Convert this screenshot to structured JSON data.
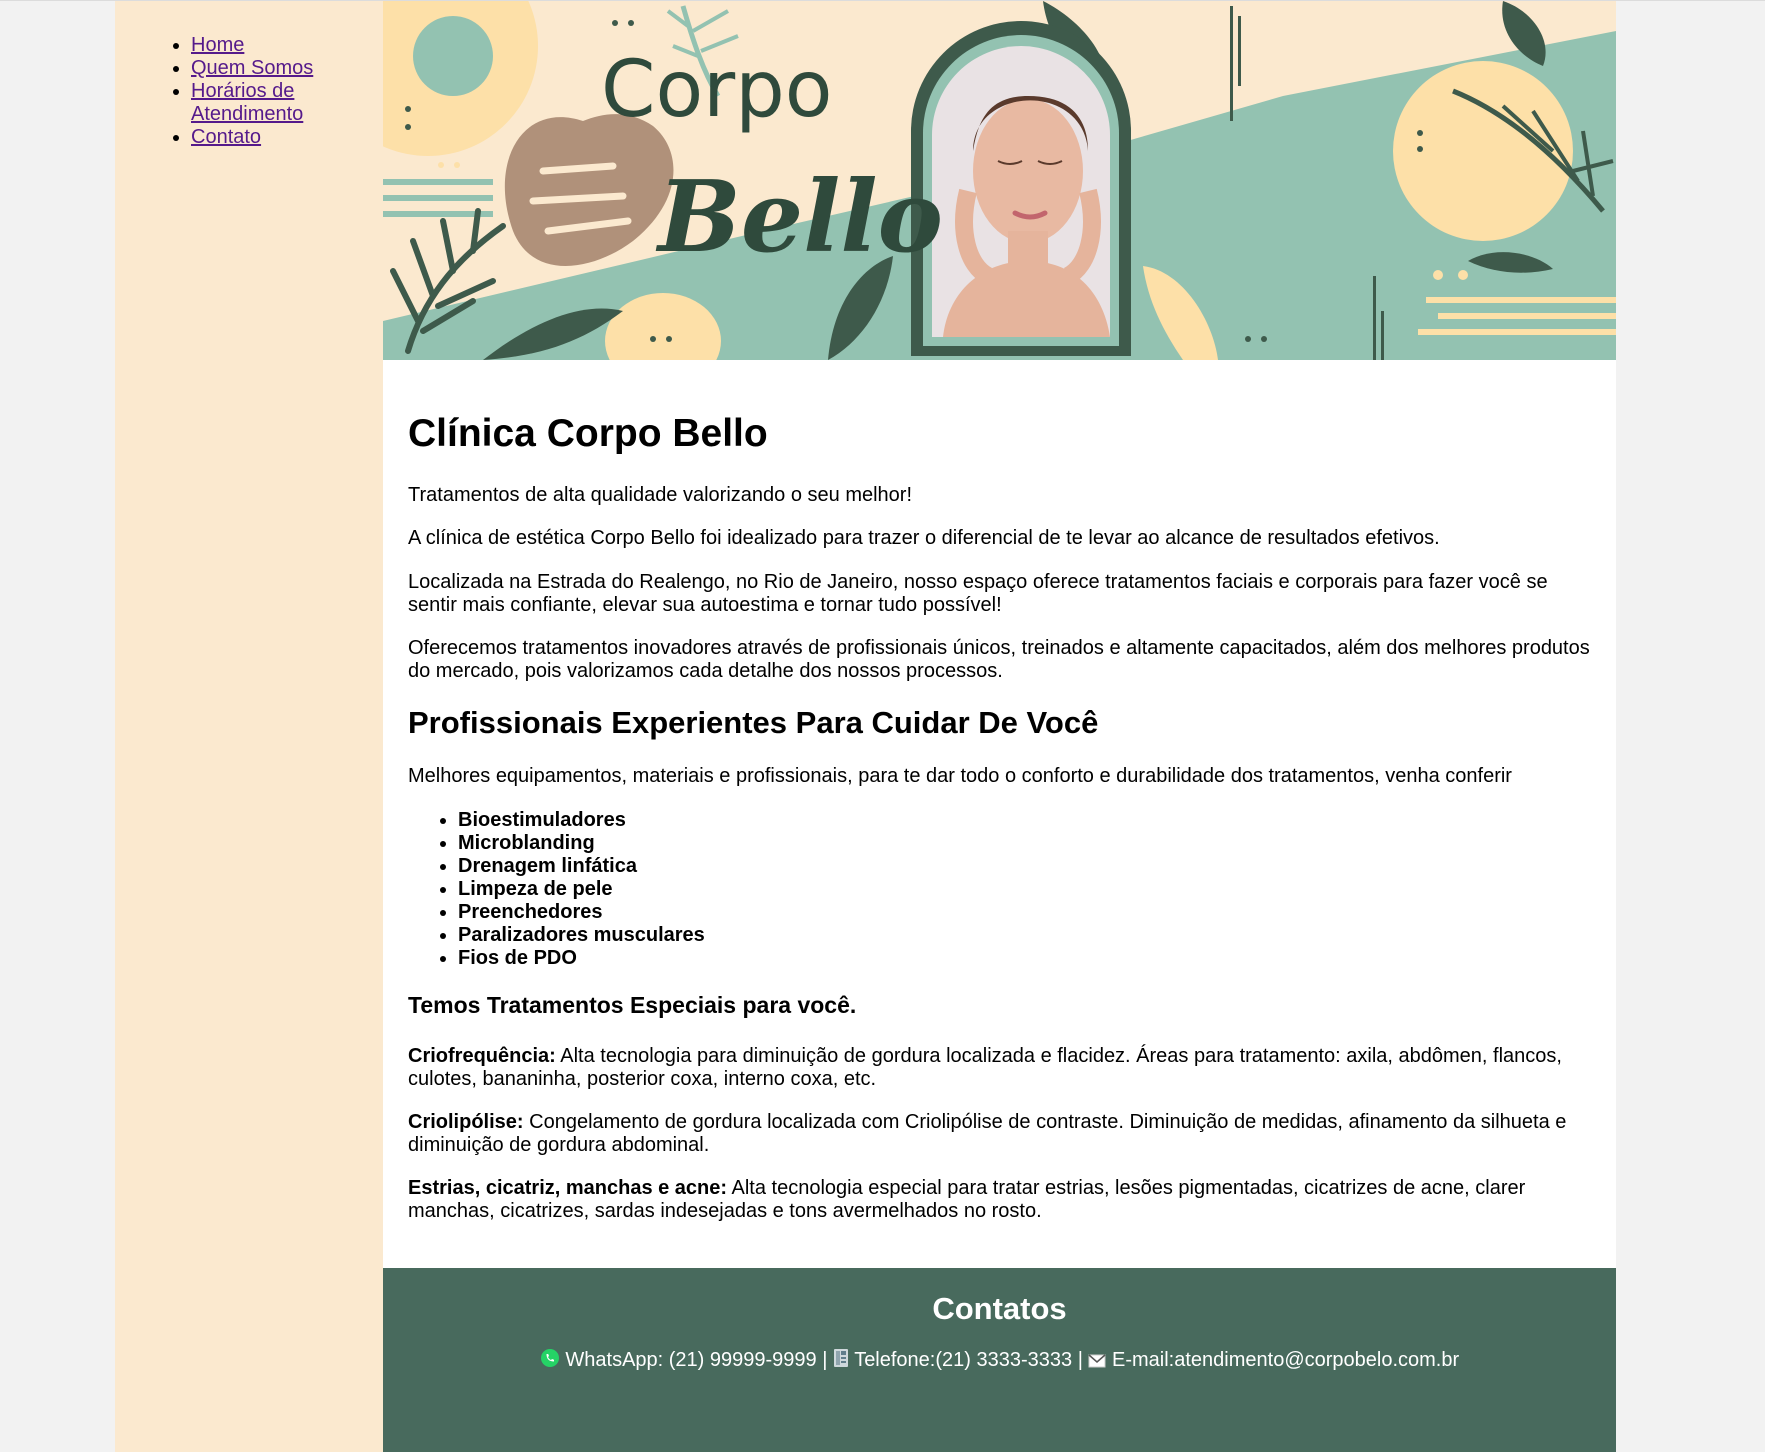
{
  "nav": {
    "items": [
      "Home",
      "Quem Somos",
      "Horários de Atendimento",
      "Contato"
    ]
  },
  "banner": {
    "brand_line1": "Corpo",
    "brand_line2": "Bello"
  },
  "main": {
    "title": "Clínica Corpo Bello",
    "intro": [
      "Tratamentos de alta qualidade valorizando o seu melhor!",
      "A clínica de estética Corpo Bello foi idealizado para trazer o diferencial de te levar ao alcance de resultados efetivos.",
      "Localizada na Estrada do Realengo, no Rio de Janeiro, nosso espaço oferece tratamentos faciais e corporais para fazer você se sentir mais confiante, elevar sua autoestima e tornar tudo possível!",
      "Oferecemos tratamentos inovadores através de profissionais únicos, treinados e altamente capacitados, além dos melhores produtos do mercado, pois valorizamos cada detalhe dos nossos processos."
    ],
    "section_title": "Profissionais Experientes Para Cuidar De Você",
    "section_text": "Melhores equipamentos, materiais e profissionais, para te dar todo o conforto e durabilidade dos tratamentos, venha conferir",
    "treatments": [
      "Bioestimuladores",
      "Microblanding",
      "Drenagem linfática",
      "Limpeza de pele",
      "Preenchedores",
      "Paralizadores musculares",
      "Fios de PDO"
    ],
    "special_title": "Temos Tratamentos Especiais para você.",
    "specials": [
      {
        "label": "Criofrequência:",
        "text": " Alta tecnologia para diminuição de gordura localizada e flacidez. Áreas para tratamento: axila, abdômen, flancos, culotes, bananinha, posterior coxa, interno coxa, etc."
      },
      {
        "label": "Criolipólise:",
        "text": " Congelamento de gordura localizada com Criolipólise de contraste. Diminuição de medidas, afinamento da silhueta e diminuição de gordura abdominal."
      },
      {
        "label": "Estrias, cicatriz, manchas e acne:",
        "text": " Alta tecnologia especial para tratar estrias, lesões pigmentadas, cicatrizes de acne, clarer manchas, cicatrizes, sardas indesejadas e tons avermelhados no rosto."
      }
    ]
  },
  "footer": {
    "title": "Contatos",
    "whatsapp": "WhatsApp: (21) 99999-9999",
    "separator": " | ",
    "phone": "Telefone:(21) 3333-3333",
    "email": "E-mail:atendimento@corpobelo.com.br"
  },
  "colors": {
    "sidebar_bg": "#fbe9cf",
    "footer_bg": "#486a5d",
    "banner_mint": "#93c2b1",
    "banner_dark_green": "#3e5a4b",
    "banner_yellow": "#fde0a8",
    "banner_tan": "#b0917a",
    "link": "#551a8b"
  },
  "icons": [
    "whatsapp-icon",
    "phone-icon",
    "envelope-icon",
    "monstera-leaf-icon",
    "palm-leaf-icon"
  ]
}
